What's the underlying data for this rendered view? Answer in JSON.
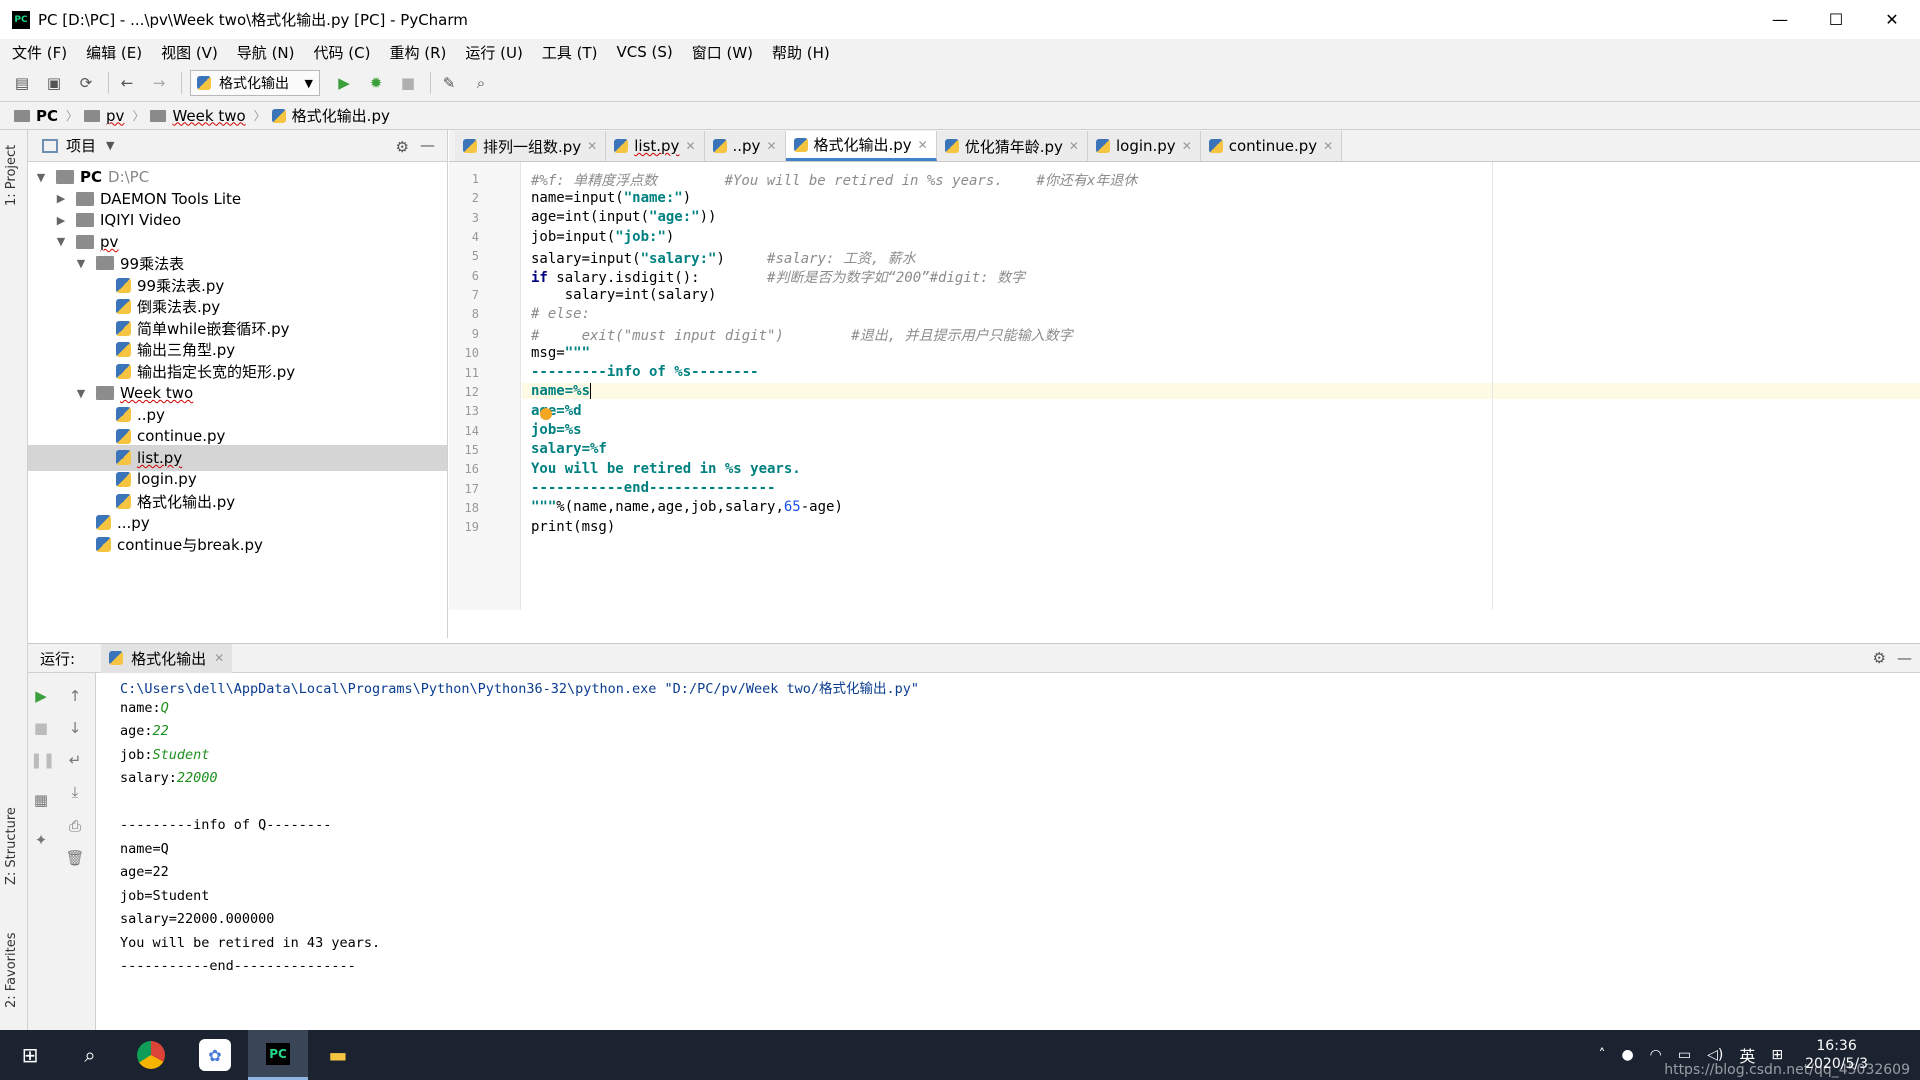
{
  "window": {
    "title": "PC [D:\\PC] - ...\\pv\\Week two\\格式化输出.py [PC] - PyCharm",
    "app_icon": "PC",
    "controls": [
      "minimize-icon",
      "maximize-icon",
      "close-icon"
    ]
  },
  "menu": [
    "文件 (F)",
    "编辑 (E)",
    "视图 (V)",
    "导航 (N)",
    "代码 (C)",
    "重构 (R)",
    "运行 (U)",
    "工具 (T)",
    "VCS (S)",
    "窗口 (W)",
    "帮助 (H)"
  ],
  "toolbar": {
    "run_config": "格式化输出",
    "icons": [
      "open-folder-icon",
      "save-icon",
      "sync-icon",
      "back-icon",
      "forward-icon",
      "run-icon",
      "debug-icon",
      "stop-icon",
      "wrench-icon",
      "search-icon"
    ]
  },
  "breadcrumb": [
    "PC",
    "pv",
    "Week two",
    "格式化输出.py"
  ],
  "side_tabs": {
    "project": "1: Project",
    "structure": "Z: Structure",
    "favorites": "2: Favorites"
  },
  "project_panel": {
    "title": "项目",
    "tree": [
      {
        "label": "PC",
        "sub": "D:\\PC",
        "depth": 0,
        "type": "folder",
        "open": true
      },
      {
        "label": "DAEMON Tools Lite",
        "depth": 1,
        "type": "folder",
        "open": false
      },
      {
        "label": "IQIYI Video",
        "depth": 1,
        "type": "folder",
        "open": false
      },
      {
        "label": "pv",
        "depth": 1,
        "type": "folder",
        "open": true
      },
      {
        "label": "99乘法表",
        "depth": 2,
        "type": "folder",
        "open": true
      },
      {
        "label": "99乘法表.py",
        "depth": 3,
        "type": "py"
      },
      {
        "label": "倒乘法表.py",
        "depth": 3,
        "type": "py"
      },
      {
        "label": "简单while嵌套循环.py",
        "depth": 3,
        "type": "py"
      },
      {
        "label": "输出三角型.py",
        "depth": 3,
        "type": "py"
      },
      {
        "label": "输出指定长宽的矩形.py",
        "depth": 3,
        "type": "py"
      },
      {
        "label": "Week two",
        "depth": 2,
        "type": "folder",
        "open": true
      },
      {
        "label": "..py",
        "depth": 3,
        "type": "py"
      },
      {
        "label": "continue.py",
        "depth": 3,
        "type": "py"
      },
      {
        "label": "list.py",
        "depth": 3,
        "type": "py",
        "selected": true
      },
      {
        "label": "login.py",
        "depth": 3,
        "type": "py"
      },
      {
        "label": "格式化输出.py",
        "depth": 3,
        "type": "py"
      },
      {
        "label": "...py",
        "depth": 2,
        "type": "py"
      },
      {
        "label": "continue与break.py",
        "depth": 2,
        "type": "py"
      }
    ]
  },
  "editor": {
    "tabs": [
      "排列一组数.py",
      "list.py",
      "..py",
      "格式化输出.py",
      "优化猜年龄.py",
      "login.py",
      "continue.py"
    ],
    "active_tab": "格式化输出.py",
    "line_numbers": [
      "1",
      "2",
      "3",
      "4",
      "5",
      "6",
      "7",
      "8",
      "9",
      "10",
      "11",
      "12",
      "13",
      "14",
      "15",
      "16",
      "17",
      "18",
      "19"
    ]
  },
  "run_panel": {
    "label": "运行:",
    "tab": "格式化输出",
    "command": "C:\\Users\\dell\\AppData\\Local\\Programs\\Python\\Python36-32\\python.exe \"D:/PC/pv/Week two/格式化输出.py\"",
    "prompts": [
      {
        "prompt": "name:",
        "input": "Q"
      },
      {
        "prompt": "age:",
        "input": "22"
      },
      {
        "prompt": "job:",
        "input": "Student"
      },
      {
        "prompt": "salary:",
        "input": "22000"
      }
    ],
    "output": [
      "---------info of Q--------",
      "name=Q",
      "age=22",
      "job=Student",
      "salary=22000.000000",
      "You will be retired in 43 years.",
      "-----------end---------------"
    ]
  },
  "taskbar": {
    "time": "16:36",
    "date": "2020/5/3",
    "ime": "英",
    "watermark": "https://blog.csdn.net/qq_45032609"
  }
}
